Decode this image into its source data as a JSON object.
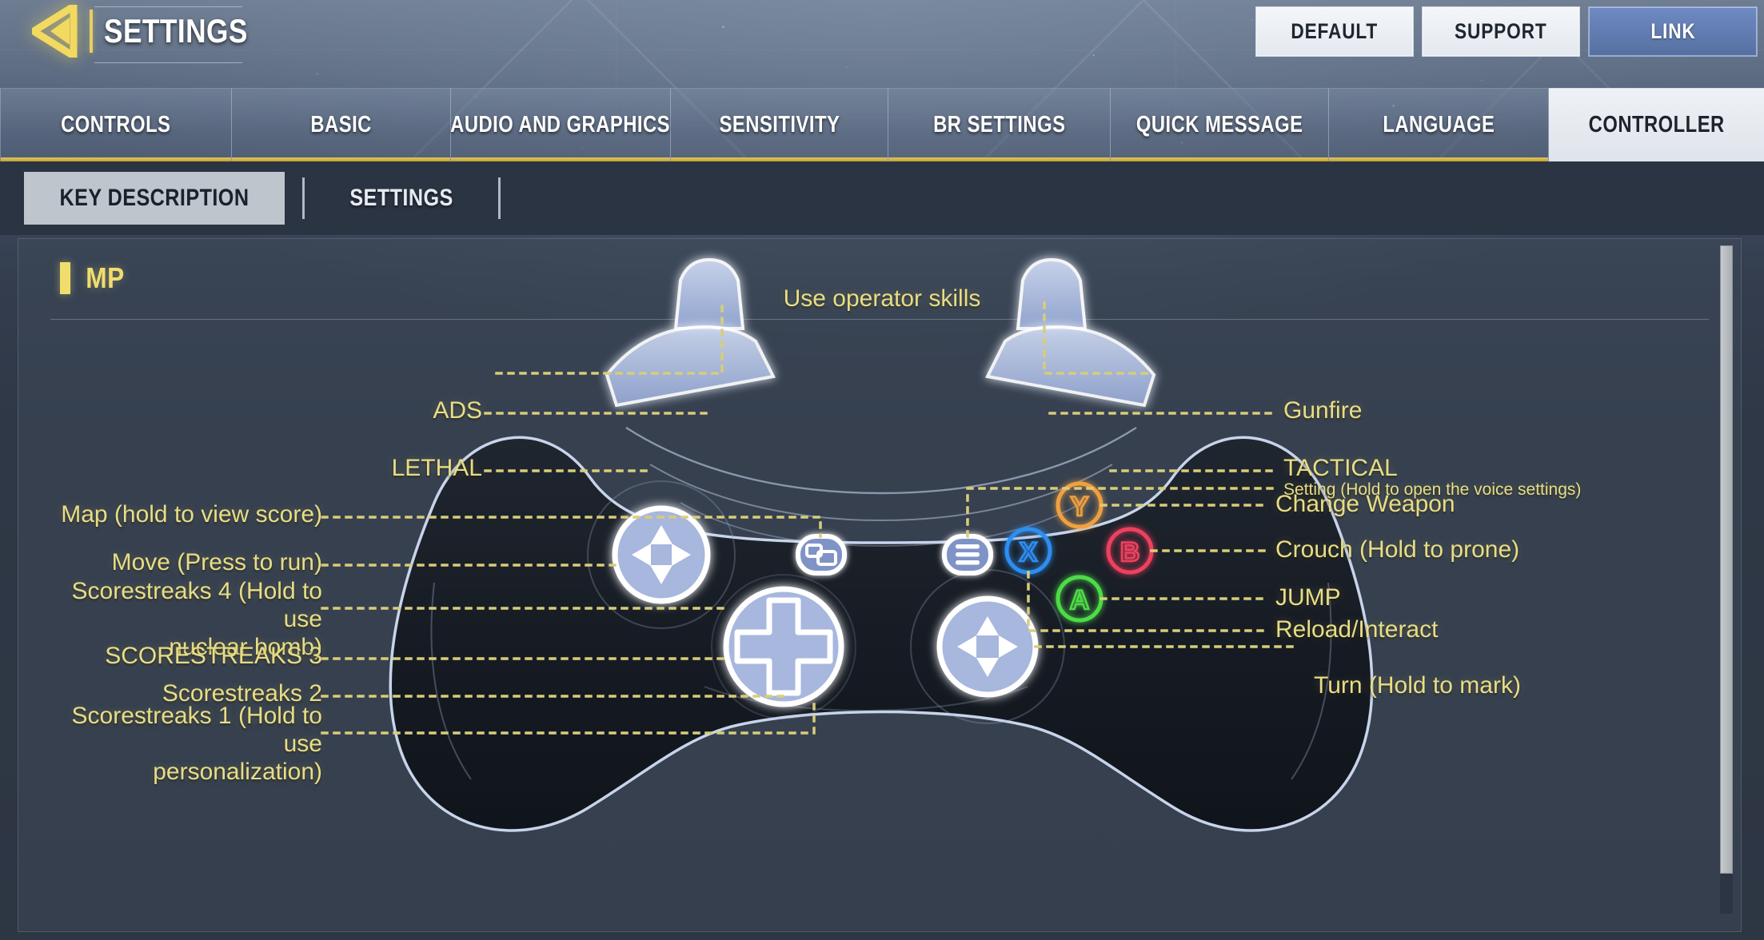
{
  "header": {
    "title": "SETTINGS",
    "back_icon": "back-arrow-icon",
    "buttons": [
      {
        "label": "DEFAULT",
        "style": "light"
      },
      {
        "label": "SUPPORT",
        "style": "light"
      },
      {
        "label": "LINK",
        "style": "primary"
      }
    ]
  },
  "tabs": [
    {
      "label": "CONTROLS",
      "active": false
    },
    {
      "label": "BASIC",
      "active": false
    },
    {
      "label": "AUDIO AND GRAPHICS",
      "active": false
    },
    {
      "label": "SENSITIVITY",
      "active": false
    },
    {
      "label": "BR SETTINGS",
      "active": false
    },
    {
      "label": "QUICK MESSAGE",
      "active": false
    },
    {
      "label": "LANGUAGE",
      "active": false
    },
    {
      "label": "CONTROLLER",
      "active": true
    }
  ],
  "subtabs": [
    {
      "label": "KEY DESCRIPTION",
      "active": true
    },
    {
      "label": "SETTINGS",
      "active": false
    }
  ],
  "section": {
    "title": "MP"
  },
  "colors": {
    "accent_yellow": "#e8dd85",
    "header_gold": "#e8cf62",
    "link_blue": "#6f8ac4",
    "button_y": "#f0a041",
    "button_b": "#ef3f5e",
    "button_a": "#4ddb46",
    "button_x": "#2e8ef0",
    "controller_highlight": "#aebde4",
    "panel_bg": "#3e4858"
  },
  "diagram": {
    "top_label": "Use operator skills",
    "left_labels": [
      {
        "text": "ADS"
      },
      {
        "text": "LETHAL"
      },
      {
        "text": "Map (hold to view score)"
      },
      {
        "text": "Move (Press to run)"
      },
      {
        "text": "Scorestreaks 4 (Hold to use\nnuclear bomb)"
      },
      {
        "text": "SCORESTREAKS 3"
      },
      {
        "text": "Scorestreaks 2"
      },
      {
        "text": "Scorestreaks 1 (Hold to use\npersonalization)"
      }
    ],
    "right_labels": [
      {
        "text": "Gunfire"
      },
      {
        "text": "TACTICAL"
      },
      {
        "text": "Setting (Hold to open the voice settings)",
        "small": true
      },
      {
        "text": "Change Weapon"
      },
      {
        "text": "Crouch (Hold to prone)"
      },
      {
        "text": "JUMP"
      },
      {
        "text": "Reload/Interact"
      },
      {
        "text": "Turn (Hold to mark)"
      }
    ],
    "face_buttons": [
      {
        "letter": "Y",
        "color": "#f0a041"
      },
      {
        "letter": "B",
        "color": "#ef3f5e"
      },
      {
        "letter": "A",
        "color": "#4ddb46"
      },
      {
        "letter": "X",
        "color": "#2e8ef0"
      }
    ],
    "center_buttons": [
      {
        "icon": "view-button-icon"
      },
      {
        "icon": "menu-button-icon"
      }
    ]
  },
  "scrollbar": {
    "position": "top"
  }
}
